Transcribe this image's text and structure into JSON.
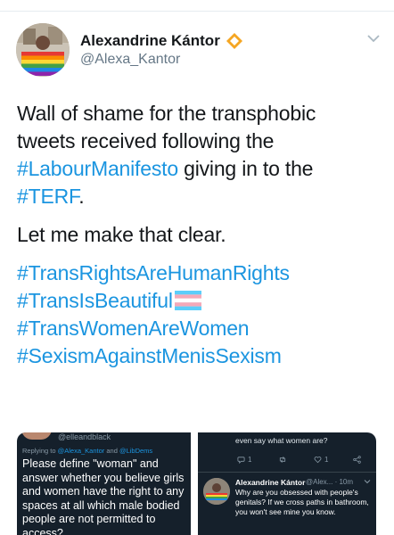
{
  "tweet": {
    "author_name": "Alexandrine Kántor",
    "author_handle": "@Alexa_Kantor",
    "text_line1": "Wall of shame for the transphobic tweets received following the ",
    "hashtag_manifesto": "#LabourManifesto",
    "text_line2": " giving in to the ",
    "hashtag_terf": "#TERF",
    "text_end": ".",
    "text_clear": "Let me make that clear.",
    "hashtags": [
      "#TransRightsAreHumanRights",
      "#TransIsBeautiful",
      "#TransWomenAreWomen",
      "#SexismAgainstMenisSexism"
    ],
    "colors": {
      "link": "#1b95e0",
      "verified_badge": "#f5a623",
      "text": "#14171a",
      "secondary": "#657786"
    }
  },
  "image_left": {
    "cut_handle": "@elleandblack",
    "reply_prefix": "Replying to ",
    "reply_mention1": "@Alexa_Kantor",
    "reply_and": " and ",
    "reply_mention2": "@LibDems",
    "text": "Please define \"woman\" and answer whether you believe girls and women have the right to any spaces at all which male bodied people are not permitted to access?"
  },
  "image_right": {
    "top_text": "even say what women are?",
    "reply_count": "1",
    "like_count": "1",
    "author_name": "Alexandrine Kántor",
    "author_meta": "@Alex... · 10m",
    "text": "Why are you obsessed with people's genitals? If we cross paths in bathroom, you won't see mine you know."
  }
}
